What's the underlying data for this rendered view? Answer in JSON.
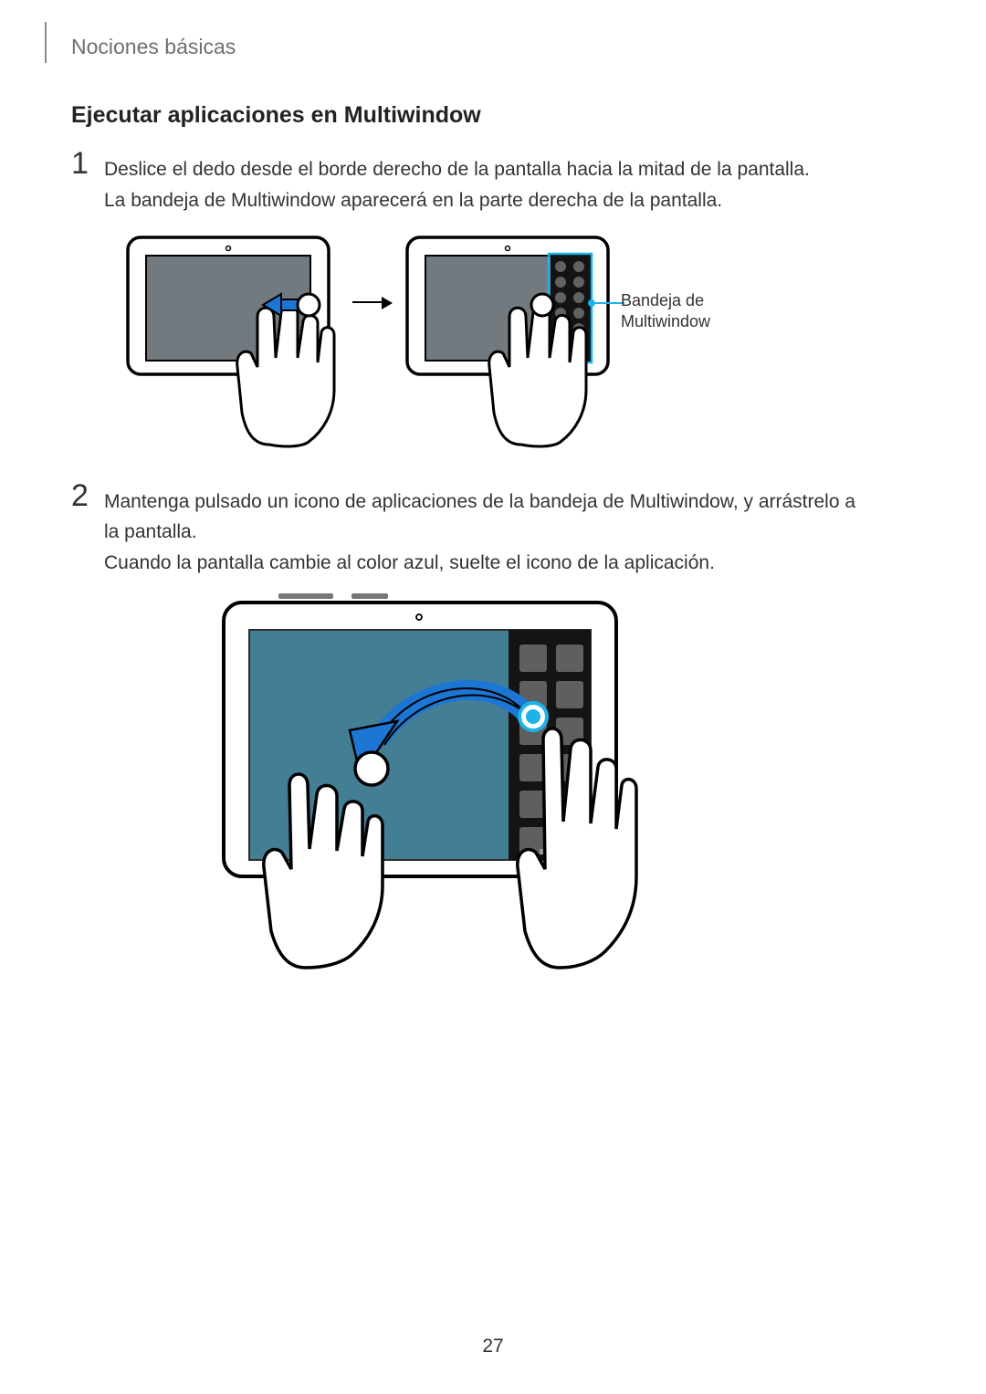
{
  "breadcrumb": "Nociones básicas",
  "heading": "Ejecutar aplicaciones en Multiwindow",
  "step1": {
    "num": "1",
    "line1": "Deslice el dedo desde el borde derecho de la pantalla hacia la mitad de la pantalla.",
    "line2": "La bandeja de Multiwindow aparecerá en la parte derecha de la pantalla."
  },
  "step2": {
    "num": "2",
    "line1": "Mantenga pulsado un icono de aplicaciones de la bandeja de Multiwindow, y arrástrelo a la pantalla.",
    "line2": "Cuando la pantalla cambie al color azul, suelte el icono de la aplicación."
  },
  "callout": {
    "line1": "Bandeja de",
    "line2": "Multiwindow"
  },
  "page_number": "27"
}
